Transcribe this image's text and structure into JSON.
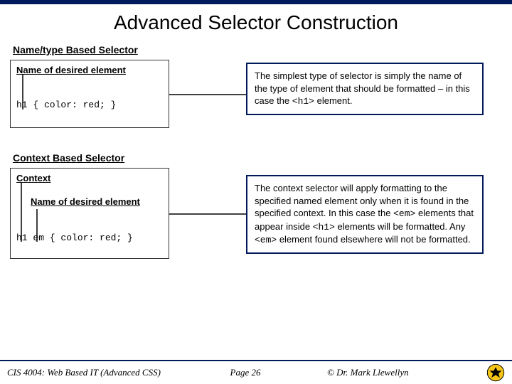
{
  "title": "Advanced Selector Construction",
  "section1": {
    "heading": "Name/type Based Selector",
    "label1": "Name of desired element",
    "code": "h1 { color: red; }",
    "explanation_parts": {
      "p1": "The simplest type of selector is simply the name of the type of element that should be formatted – in this case the ",
      "code1": "<h1>",
      "p2": " element."
    }
  },
  "section2": {
    "heading": "Context Based Selector",
    "label_context": "Context",
    "label_name": "Name of desired element",
    "code": "h1 em { color: red; }",
    "explanation_parts": {
      "p1": "The context selector will apply formatting to the specified named element only when it is found in the specified context.  In this case the ",
      "code1": "<em>",
      "p2": " elements that appear inside ",
      "code2": "<h1>",
      "p3": " elements will be formatted.  Any ",
      "code3": "<em>",
      "p4": " element found elsewhere will not be formatted."
    }
  },
  "footer": {
    "course": "CIS 4004: Web Based IT (Advanced CSS)",
    "page": "Page 26",
    "copyright": "© Dr. Mark Llewellyn"
  }
}
